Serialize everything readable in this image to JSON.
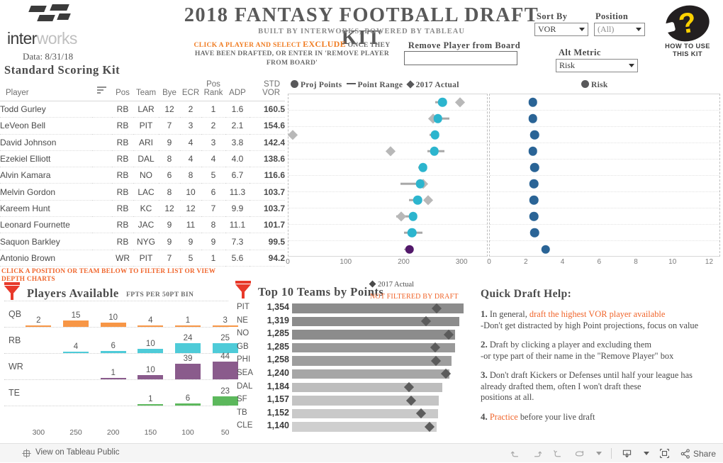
{
  "header": {
    "logo_text_a": "inter",
    "logo_text_b": "works",
    "data_date": "Data: 8/31/18",
    "title": "2018 FANTASY FOOTBALL DRAFT KIT",
    "subtitle": "BUILT BY INTERWORKS, POWERED BY TABLEAU",
    "instruction_pre": "CLICK A PLAYER AND SELECT ",
    "instruction_exclude": "EXCLUDE",
    "instruction_post": " ONCE THEY HAVE BEEN DRAFTED, OR ENTER IN 'REMOVE PLAYER FROM BOARD'",
    "remove_label": "Remove Player from Board",
    "remove_value": "",
    "remove_placeholder": "",
    "sort_by_label": "Sort By",
    "sort_by_value": "VOR",
    "position_label": "Position",
    "position_value": "(All)",
    "alt_metric_label": "Alt Metric",
    "alt_metric_value": "Risk",
    "help_badge_text": "HOW TO USE THIS KIT",
    "help_badge_glyph": "?"
  },
  "table": {
    "kit_title": "Standard Scoring Kit",
    "columns": [
      "Player",
      "",
      "Pos",
      "Team",
      "Bye",
      "ECR",
      "Pos Rank",
      "ADP",
      "STD VOR"
    ],
    "col_pos_rank_line1": "Pos",
    "col_pos_rank_line2": "Rank",
    "rows": [
      {
        "player": "Todd Gurley",
        "pos": "RB",
        "team": "LAR",
        "bye": "12",
        "ecr": "2",
        "pos_rank": "1",
        "adp": "1.6",
        "vor": "160.5"
      },
      {
        "player": "LeVeon Bell",
        "pos": "RB",
        "team": "PIT",
        "bye": "7",
        "ecr": "3",
        "pos_rank": "2",
        "adp": "2.1",
        "vor": "154.6"
      },
      {
        "player": "David Johnson",
        "pos": "RB",
        "team": "ARI",
        "bye": "9",
        "ecr": "4",
        "pos_rank": "3",
        "adp": "3.8",
        "vor": "142.4"
      },
      {
        "player": "Ezekiel Elliott",
        "pos": "RB",
        "team": "DAL",
        "bye": "8",
        "ecr": "4",
        "pos_rank": "4",
        "adp": "4.0",
        "vor": "138.6"
      },
      {
        "player": "Alvin Kamara",
        "pos": "RB",
        "team": "NO",
        "bye": "6",
        "ecr": "8",
        "pos_rank": "5",
        "adp": "6.7",
        "vor": "116.6"
      },
      {
        "player": "Melvin Gordon",
        "pos": "RB",
        "team": "LAC",
        "bye": "8",
        "ecr": "10",
        "pos_rank": "6",
        "adp": "11.3",
        "vor": "103.7"
      },
      {
        "player": "Kareem Hunt",
        "pos": "RB",
        "team": "KC",
        "bye": "12",
        "ecr": "12",
        "pos_rank": "7",
        "adp": "9.9",
        "vor": "103.7"
      },
      {
        "player": "Leonard Fournette",
        "pos": "RB",
        "team": "JAC",
        "bye": "9",
        "ecr": "11",
        "pos_rank": "8",
        "adp": "11.1",
        "vor": "101.7"
      },
      {
        "player": "Saquon Barkley",
        "pos": "RB",
        "team": "NYG",
        "bye": "9",
        "ecr": "9",
        "pos_rank": "9",
        "adp": "7.3",
        "vor": "99.5"
      },
      {
        "player": "Antonio Brown",
        "pos": "WR",
        "team": "PIT",
        "bye": "7",
        "ecr": "5",
        "pos_rank": "1",
        "adp": "5.6",
        "vor": "94.2"
      }
    ]
  },
  "chart_data": [
    {
      "type": "scatter",
      "name": "proj-points-dot-plot",
      "title": "",
      "legend": [
        {
          "label": "Proj Points",
          "marker": "circle",
          "color": "#58585a"
        },
        {
          "label": "Point Range",
          "marker": "line",
          "color": "#58585a"
        },
        {
          "label": "2017 Actual",
          "marker": "diamond",
          "color": "#58585a"
        }
      ],
      "legend_position": "top-left",
      "xlabel": "",
      "ylabel": "",
      "xlim": [
        0,
        345
      ],
      "ticks": [
        0,
        100,
        200,
        300
      ],
      "grid": true,
      "categories": [
        "Todd Gurley",
        "LeVeon Bell",
        "David Johnson",
        "Ezekiel Elliott",
        "Alvin Kamara",
        "Melvin Gordon",
        "Kareem Hunt",
        "Leonard Fournette",
        "Saquon Barkley",
        "Antonio Brown"
      ],
      "series": [
        {
          "name": "Proj Points",
          "marker": "circle",
          "color": "#2cb5ce",
          "values": [
            266,
            258,
            253,
            252,
            232,
            227,
            223,
            215,
            213,
            209
          ]
        },
        {
          "name": "Point Range Low",
          "color": "#a8a8a8",
          "values": [
            253,
            252,
            244,
            240,
            224,
            193,
            208,
            186,
            200,
            199
          ]
        },
        {
          "name": "Point Range High",
          "color": "#a8a8a8",
          "values": [
            271,
            278,
            259,
            269,
            234,
            231,
            227,
            218,
            231,
            213
          ]
        },
        {
          "name": "2017 Actual",
          "marker": "diamond",
          "color": "#b8b8b8",
          "values": [
            296,
            250,
            7,
            176,
            null,
            232,
            241,
            194,
            null,
            null
          ]
        }
      ],
      "highlight": {
        "category": "Antonio Brown",
        "color": "#52186a"
      }
    },
    {
      "type": "scatter",
      "name": "risk-dot-plot",
      "title": "",
      "legend": [
        {
          "label": "Risk",
          "marker": "circle",
          "color": "#58585a"
        }
      ],
      "legend_position": "top",
      "xlabel": "",
      "ylabel": "",
      "xlim": [
        0,
        12.6
      ],
      "ticks": [
        0,
        2,
        4,
        6,
        8,
        10,
        12
      ],
      "grid": true,
      "categories": [
        "Todd Gurley",
        "LeVeon Bell",
        "David Johnson",
        "Ezekiel Elliott",
        "Alvin Kamara",
        "Melvin Gordon",
        "Kareem Hunt",
        "Leonard Fournette",
        "Saquon Barkley",
        "Antonio Brown"
      ],
      "series": [
        {
          "name": "Risk",
          "marker": "circle",
          "color": "#2a6496",
          "values": [
            2.35,
            2.35,
            2.45,
            2.35,
            2.45,
            2.4,
            2.4,
            2.4,
            2.45,
            3.05
          ]
        }
      ]
    },
    {
      "type": "bar",
      "name": "players-available",
      "title": "Players Available",
      "subtitle": "FPTS PER 50PT BIN",
      "note": "CLICK A POSITION OR TEAM BELOW TO FILTER LIST OR VIEW DEPTH CHARTS",
      "categories": [
        "300",
        "250",
        "200",
        "150",
        "100",
        "50"
      ],
      "xlabel": "",
      "ylabel": "",
      "grid": true,
      "series": [
        {
          "name": "QB",
          "color": "#f79646",
          "values": [
            2,
            15,
            10,
            4,
            1,
            3
          ]
        },
        {
          "name": "RB",
          "color": "#4ecbd8",
          "values": [
            null,
            4,
            6,
            10,
            24,
            25
          ]
        },
        {
          "name": "WR",
          "color": "#8a5b8c",
          "values": [
            null,
            null,
            1,
            10,
            39,
            44
          ]
        },
        {
          "name": "TE",
          "color": "#5cb85c",
          "values": [
            null,
            null,
            null,
            1,
            6,
            23
          ]
        }
      ]
    },
    {
      "type": "bar",
      "name": "top-10-teams-by-points",
      "title": "Top 10 Teams by Points",
      "legend_label": "2017 Actual",
      "note": "NOT FILTERED BY DRAFT",
      "orientation": "horizontal",
      "categories": [
        "PIT",
        "NE",
        "NO",
        "GB",
        "PHI",
        "SEA",
        "DAL",
        "SF",
        "TB",
        "CLE"
      ],
      "values": [
        1354,
        1319,
        1285,
        1285,
        1258,
        1240,
        1184,
        1157,
        1152,
        1140
      ],
      "value_labels": [
        "1,354",
        "1,319",
        "1,285",
        "1,285",
        "1,258",
        "1,240",
        "1,184",
        "1,157",
        "1,152",
        "1,140"
      ],
      "actual_2017": [
        1140,
        1058,
        1235,
        1130,
        1133,
        1215,
        925,
        940,
        1018,
        1086
      ],
      "bar_colors": [
        "#8c8c8c",
        "#8c8c8c",
        "#8c8c8c",
        "#999999",
        "#9e9e9e",
        "#a6a6a6",
        "#bdbdbd",
        "#c4c4c4",
        "#c9c9c9",
        "#cfcfcf"
      ],
      "marker_color": "#5b5b5b",
      "xlim": [
        0,
        1420
      ]
    }
  ],
  "help": {
    "title": "Quick Draft Help:",
    "items": [
      {
        "num": "1.",
        "pre": " In general, ",
        "hl": "draft the highest VOR player available",
        "post": "",
        "line2": "-Don't get distracted by high Point projections, focus on value"
      },
      {
        "num": "2.",
        "pre": " Draft by clicking a player and excluding them",
        "hl": "",
        "post": "",
        "line2": "   -or type part of their name in the \"Remove Player\" box"
      },
      {
        "num": "3.",
        "pre": " Don't draft Kickers or Defenses until half your league has",
        "hl": "",
        "post": "",
        "line2": "already drafted them, often I won't draft these",
        "line3": "positions at all."
      },
      {
        "num": "4.",
        "pre": " ",
        "hl": "Practice",
        "post": " before your live draft",
        "line2": ""
      }
    ]
  },
  "toolbar": {
    "view_on_tableau": "View on Tableau Public",
    "share_label": "Share",
    "undo_label": "Undo",
    "redo_label": "Redo",
    "revert_label": "Revert",
    "refresh_label": "Refresh",
    "download_label": "Download",
    "fullscreen_label": "Full Screen"
  }
}
